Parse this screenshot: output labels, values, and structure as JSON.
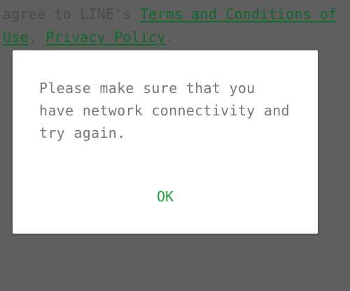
{
  "background": {
    "terms_prefix": "agree to LINE's ",
    "terms_link": "Terms and Conditions of",
    "terms_link_cont": "Use",
    "separator": ", ",
    "privacy_link": "Privacy Policy",
    "terms_suffix": "."
  },
  "dialog": {
    "message": "Please make sure that you\nhave network connectivity and\ntry again.",
    "ok_label": "OK"
  },
  "colors": {
    "overlay": "#5f5f5f",
    "dialog_bg": "#ffffff",
    "message_text": "#777777",
    "link_green": "#0f6a2a",
    "ok_green": "#22a03a"
  }
}
